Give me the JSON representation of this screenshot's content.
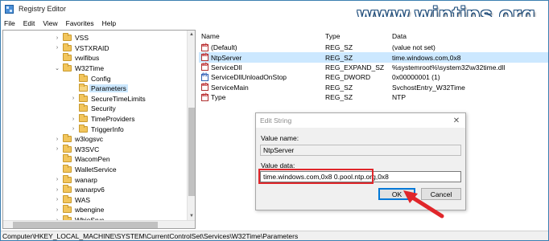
{
  "window": {
    "title": "Registry Editor"
  },
  "watermark": "www.wintips.org",
  "menu": [
    "File",
    "Edit",
    "View",
    "Favorites",
    "Help"
  ],
  "tree": {
    "items": [
      {
        "label": "VSS",
        "expander": "›",
        "level": 1
      },
      {
        "label": "VSTXRAID",
        "expander": "›",
        "level": 1
      },
      {
        "label": "vwifibus",
        "expander": "",
        "level": 1
      },
      {
        "label": "W32Time",
        "expander": "⌄",
        "level": 1
      },
      {
        "label": "Config",
        "expander": "",
        "level": 2
      },
      {
        "label": "Parameters",
        "expander": "",
        "level": 2,
        "selected": true
      },
      {
        "label": "SecureTimeLimits",
        "expander": "›",
        "level": 2
      },
      {
        "label": "Security",
        "expander": "",
        "level": 2
      },
      {
        "label": "TimeProviders",
        "expander": "›",
        "level": 2
      },
      {
        "label": "TriggerInfo",
        "expander": "›",
        "level": 2
      },
      {
        "label": "w3logsvc",
        "expander": "›",
        "level": 1
      },
      {
        "label": "W3SVC",
        "expander": "›",
        "level": 1
      },
      {
        "label": "WacomPen",
        "expander": "",
        "level": 1
      },
      {
        "label": "WalletService",
        "expander": "",
        "level": 1
      },
      {
        "label": "wanarp",
        "expander": "›",
        "level": 1
      },
      {
        "label": "wanarpv6",
        "expander": "›",
        "level": 1
      },
      {
        "label": "WAS",
        "expander": "›",
        "level": 1
      },
      {
        "label": "wbengine",
        "expander": "›",
        "level": 1
      },
      {
        "label": "WbioSrvc",
        "expander": "›",
        "level": 1
      }
    ]
  },
  "list": {
    "headers": {
      "name": "Name",
      "type": "Type",
      "data": "Data"
    },
    "rows": [
      {
        "icon": "string-value-icon",
        "name": "(Default)",
        "type": "REG_SZ",
        "data": "(value not set)"
      },
      {
        "icon": "string-value-icon",
        "name": "NtpServer",
        "type": "REG_SZ",
        "data": "time.windows.com,0x8",
        "selected": true
      },
      {
        "icon": "string-value-icon",
        "name": "ServiceDll",
        "type": "REG_EXPAND_SZ",
        "data": "%systemroot%\\system32\\w32time.dll"
      },
      {
        "icon": "dword-value-icon",
        "name": "ServiceDllUnloadOnStop",
        "type": "REG_DWORD",
        "data": "0x00000001 (1)"
      },
      {
        "icon": "string-value-icon",
        "name": "ServiceMain",
        "type": "REG_SZ",
        "data": "SvchostEntry_W32Time"
      },
      {
        "icon": "string-value-icon",
        "name": "Type",
        "type": "REG_SZ",
        "data": "NTP"
      }
    ]
  },
  "dialog": {
    "title": "Edit String",
    "value_name_label": "Value name:",
    "value_name": "NtpServer",
    "value_data_label": "Value data:",
    "value_data": "time.windows.com,0x8 0.pool.ntp.org,0x8",
    "ok_label": "OK",
    "cancel_label": "Cancel",
    "close_glyph": "✕"
  },
  "status": {
    "path": "Computer\\HKEY_LOCAL_MACHINE\\SYSTEM\\CurrentControlSet\\Services\\W32Time\\Parameters"
  },
  "colors": {
    "selection": "#cce8ff",
    "highlight_border": "#e0262a",
    "arrow": "#e0262a",
    "ok_border": "#0078d7"
  }
}
